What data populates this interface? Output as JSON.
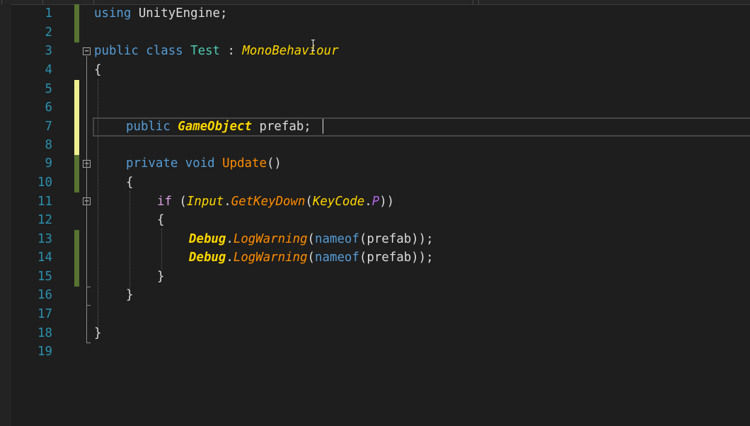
{
  "editor": {
    "language": "csharp",
    "current_line": 7,
    "line_numbers": [
      "1",
      "2",
      "3",
      "4",
      "5",
      "6",
      "7",
      "8",
      "9",
      "10",
      "11",
      "12",
      "13",
      "14",
      "15",
      "16",
      "17",
      "18",
      "19"
    ]
  },
  "colors": {
    "background": "#1e1e1e",
    "line_number": "#2b91af",
    "keyword": "#569cd6",
    "class_name": "#4ec9b0",
    "italic_type": "#ffd700",
    "method": "#ff8c00",
    "control_keyword": "#d8a0df",
    "enum_member": "#b267e6",
    "saved_change_marker": "#577430",
    "unsaved_change_marker": "#efef91"
  },
  "change_markers": {
    "saved_lines": [
      1,
      2,
      9,
      10,
      13,
      14,
      15
    ],
    "unsaved_lines": [
      5,
      6,
      7,
      8
    ]
  },
  "fold_markers": {
    "collapsible_lines": [
      3,
      9,
      11
    ],
    "glyph": "−"
  },
  "code": {
    "l1": {
      "kw_using": "using",
      "ns": " UnityEngine",
      "semi": ";"
    },
    "l3": {
      "kw_public": "public",
      "kw_class": " class",
      "class_name": " Test",
      "colon": " : ",
      "base": "MonoBehaviour"
    },
    "l4": {
      "brace": "{"
    },
    "l7": {
      "kw_public": "public",
      "type": " GameObject",
      "field": " prefab",
      "semi": ";"
    },
    "l9": {
      "kw_private": "private",
      "kw_void": " void",
      "method": " Update",
      "parens": "()"
    },
    "l10": {
      "brace": "{"
    },
    "l11": {
      "kw_if": "if",
      "paren_open": " (",
      "cls_input": "Input",
      "dot1": ".",
      "method": "GetKeyDown",
      "paren2": "(",
      "cls_keycode": "KeyCode",
      "dot2": ".",
      "enum_member": "P",
      "close": "))"
    },
    "l12": {
      "brace": "{"
    },
    "l13": {
      "cls_debug": "Debug",
      "dot": ".",
      "method": "LogWarning",
      "paren1": "(",
      "kw_nameof": "nameof",
      "paren2": "(",
      "arg": "prefab",
      "close": "));"
    },
    "l14": {
      "cls_debug": "Debug",
      "dot": ".",
      "method": "LogWarning",
      "paren1": "(",
      "kw_nameof": "nameof",
      "paren2": "(",
      "arg": "prefab",
      "close": "));"
    },
    "l15": {
      "brace": "}"
    },
    "l16": {
      "brace": "}"
    },
    "l18": {
      "brace": "}"
    }
  }
}
